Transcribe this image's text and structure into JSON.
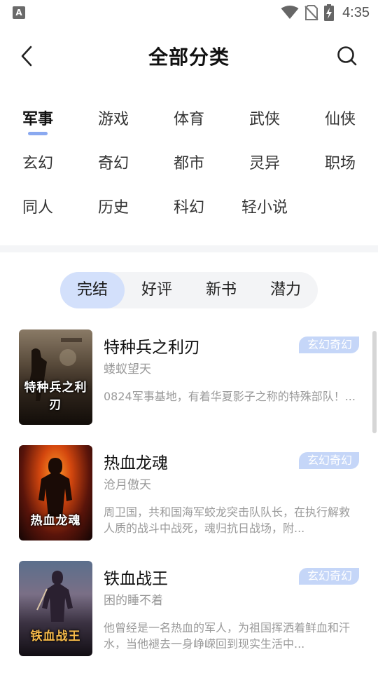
{
  "status_bar": {
    "left_badge": "A",
    "time": "4:35"
  },
  "header": {
    "title": "全部分类"
  },
  "categories": {
    "active_index": 0,
    "rows": [
      [
        "军事",
        "游戏",
        "体育",
        "武侠",
        "仙侠"
      ],
      [
        "玄幻",
        "奇幻",
        "都市",
        "灵异",
        "职场"
      ],
      [
        "同人",
        "历史",
        "科幻",
        "轻小说"
      ]
    ]
  },
  "filter_tabs": {
    "active_index": 0,
    "items": [
      "完结",
      "好评",
      "新书",
      "潜力"
    ]
  },
  "books": [
    {
      "title": "特种兵之利刃",
      "author": "蝼蚁望天",
      "tag": "玄幻奇幻",
      "desc": "0824军事基地，有着华夏影子之称的特殊部队！...",
      "cover_title": "特种兵之利刃"
    },
    {
      "title": "热血龙魂",
      "author": "沧月傲天",
      "tag": "玄幻奇幻",
      "desc": "周卫国，共和国海军蛟龙突击队队长，在执行解救人质的战斗中战死，魂归抗日战场，附...",
      "cover_title": "热血龙魂"
    },
    {
      "title": "铁血战王",
      "author": "困的睡不着",
      "tag": "玄幻奇幻",
      "desc": "他曾经是一名热血的军人，为祖国挥洒着鲜血和汗水，当他褪去一身峥嵘回到现实生活中...",
      "cover_title": "铁血战王"
    }
  ],
  "colors": {
    "accent": "#8aa9f0",
    "tab_active_bg": "#d3e0fb",
    "tag_bg": "#c5d6f8"
  }
}
